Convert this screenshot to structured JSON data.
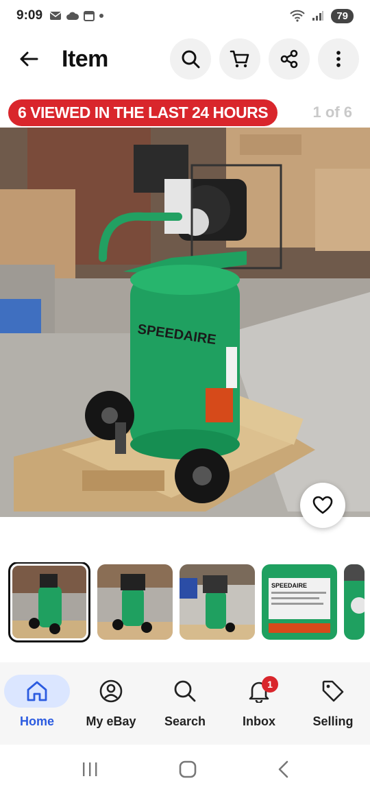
{
  "status_bar": {
    "time": "9:09",
    "battery": "79",
    "icons": [
      "mail-icon",
      "cloud-icon",
      "calendar-icon",
      "dot-icon",
      "wifi-icon",
      "signal-icon"
    ]
  },
  "header": {
    "title": "Item",
    "actions": [
      "search-icon",
      "cart-icon",
      "share-icon",
      "more-icon"
    ]
  },
  "banner": {
    "viewed_text": "6 VIEWED IN THE LAST 24 HOURS",
    "counter": "1 of 6"
  },
  "hero_image": {
    "description_icon": "air-compressor-photo",
    "brand_text": "SPEEDAIRE"
  },
  "thumbnails": {
    "count": 5,
    "selected_index": 0
  },
  "bottom_nav": {
    "items": [
      {
        "label": "Home",
        "icon": "home-icon",
        "active": true
      },
      {
        "label": "My eBay",
        "icon": "profile-icon",
        "active": false
      },
      {
        "label": "Search",
        "icon": "search-icon",
        "active": false
      },
      {
        "label": "Inbox",
        "icon": "bell-icon",
        "active": false,
        "badge": "1"
      },
      {
        "label": "Selling",
        "icon": "tag-icon",
        "active": false
      }
    ]
  },
  "colors": {
    "accent_red": "#d9262c",
    "active_blue": "#2b5be0",
    "active_bg": "#dbe6ff",
    "compressor_green": "#1fa060"
  }
}
